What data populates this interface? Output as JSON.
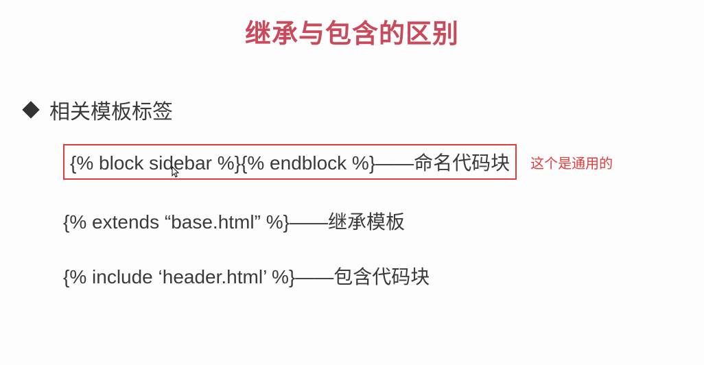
{
  "title": "继承与包含的区别",
  "section_label": "相关模板标签",
  "lines": {
    "block": "{% block sidebar %}{% endblock %}——命名代码块",
    "block_note": "这个是通用的",
    "extends": "{% extends “base.html” %}——继承模板",
    "include": "{% include ‘header.html’ %}——包含代码块"
  }
}
